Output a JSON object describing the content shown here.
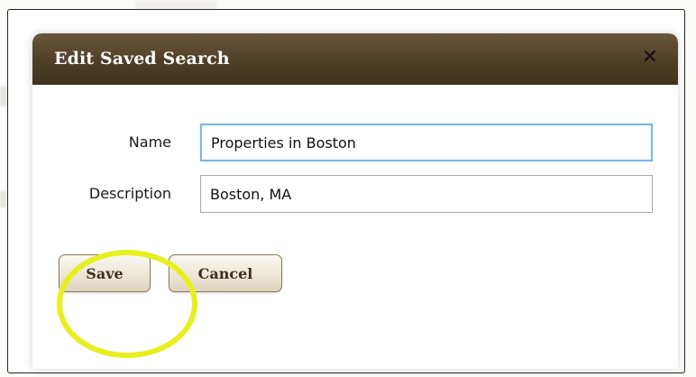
{
  "dialog": {
    "title": "Edit Saved Search",
    "close_glyph": "✕"
  },
  "form": {
    "name_label": "Name",
    "name_value": "Properties in Boston",
    "description_label": "Description",
    "description_value": "Boston, MA"
  },
  "buttons": {
    "save_label": "Save",
    "cancel_label": "Cancel"
  },
  "colors": {
    "titlebar": "#4f3f26",
    "highlight": "#e6f01e",
    "focus_border": "#7fb6e3"
  }
}
